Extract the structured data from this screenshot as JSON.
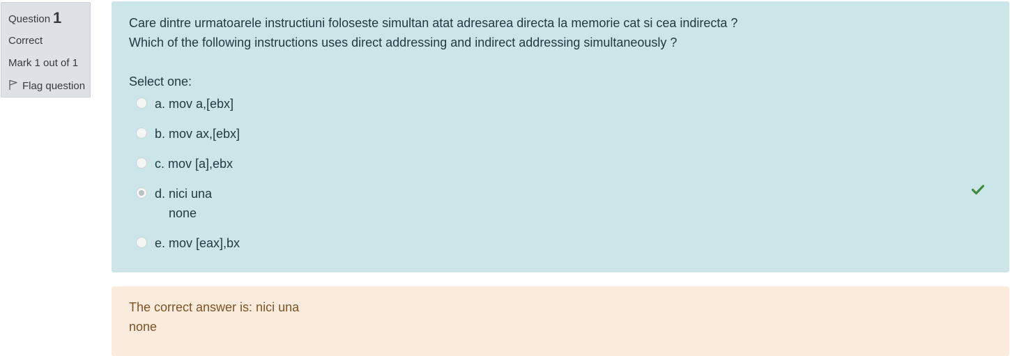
{
  "info": {
    "question_label": "Question",
    "question_number": "1",
    "state": "Correct",
    "grade": "Mark 1 out of 1",
    "flag_label": "Flag question"
  },
  "question": {
    "text_ro": "Care dintre urmatoarele instructiuni foloseste simultan atat adresarea directa la memorie cat si cea indirecta ?",
    "text_en": "Which of the following instructions uses direct addressing and indirect addressing simultaneously ?",
    "prompt": "Select one:",
    "options": [
      {
        "label": "a. mov a,[ebx]"
      },
      {
        "label": "b. mov ax,[ebx]"
      },
      {
        "label": "c. mov [a],ebx"
      },
      {
        "label": "d. nici una",
        "label_line2": "none",
        "selected": true,
        "correct": true
      },
      {
        "label": "e. mov [eax],bx"
      }
    ]
  },
  "feedback": {
    "line1": "The correct answer is: nici una",
    "line2": "none"
  },
  "colors": {
    "formulation_bg": "#cce5e9",
    "feedback_bg": "#fbebdc",
    "info_bg": "#dee2e6",
    "correct_check": "#3c8c3c"
  },
  "icons": {
    "flag": "flag-icon",
    "correct": "check-icon"
  }
}
